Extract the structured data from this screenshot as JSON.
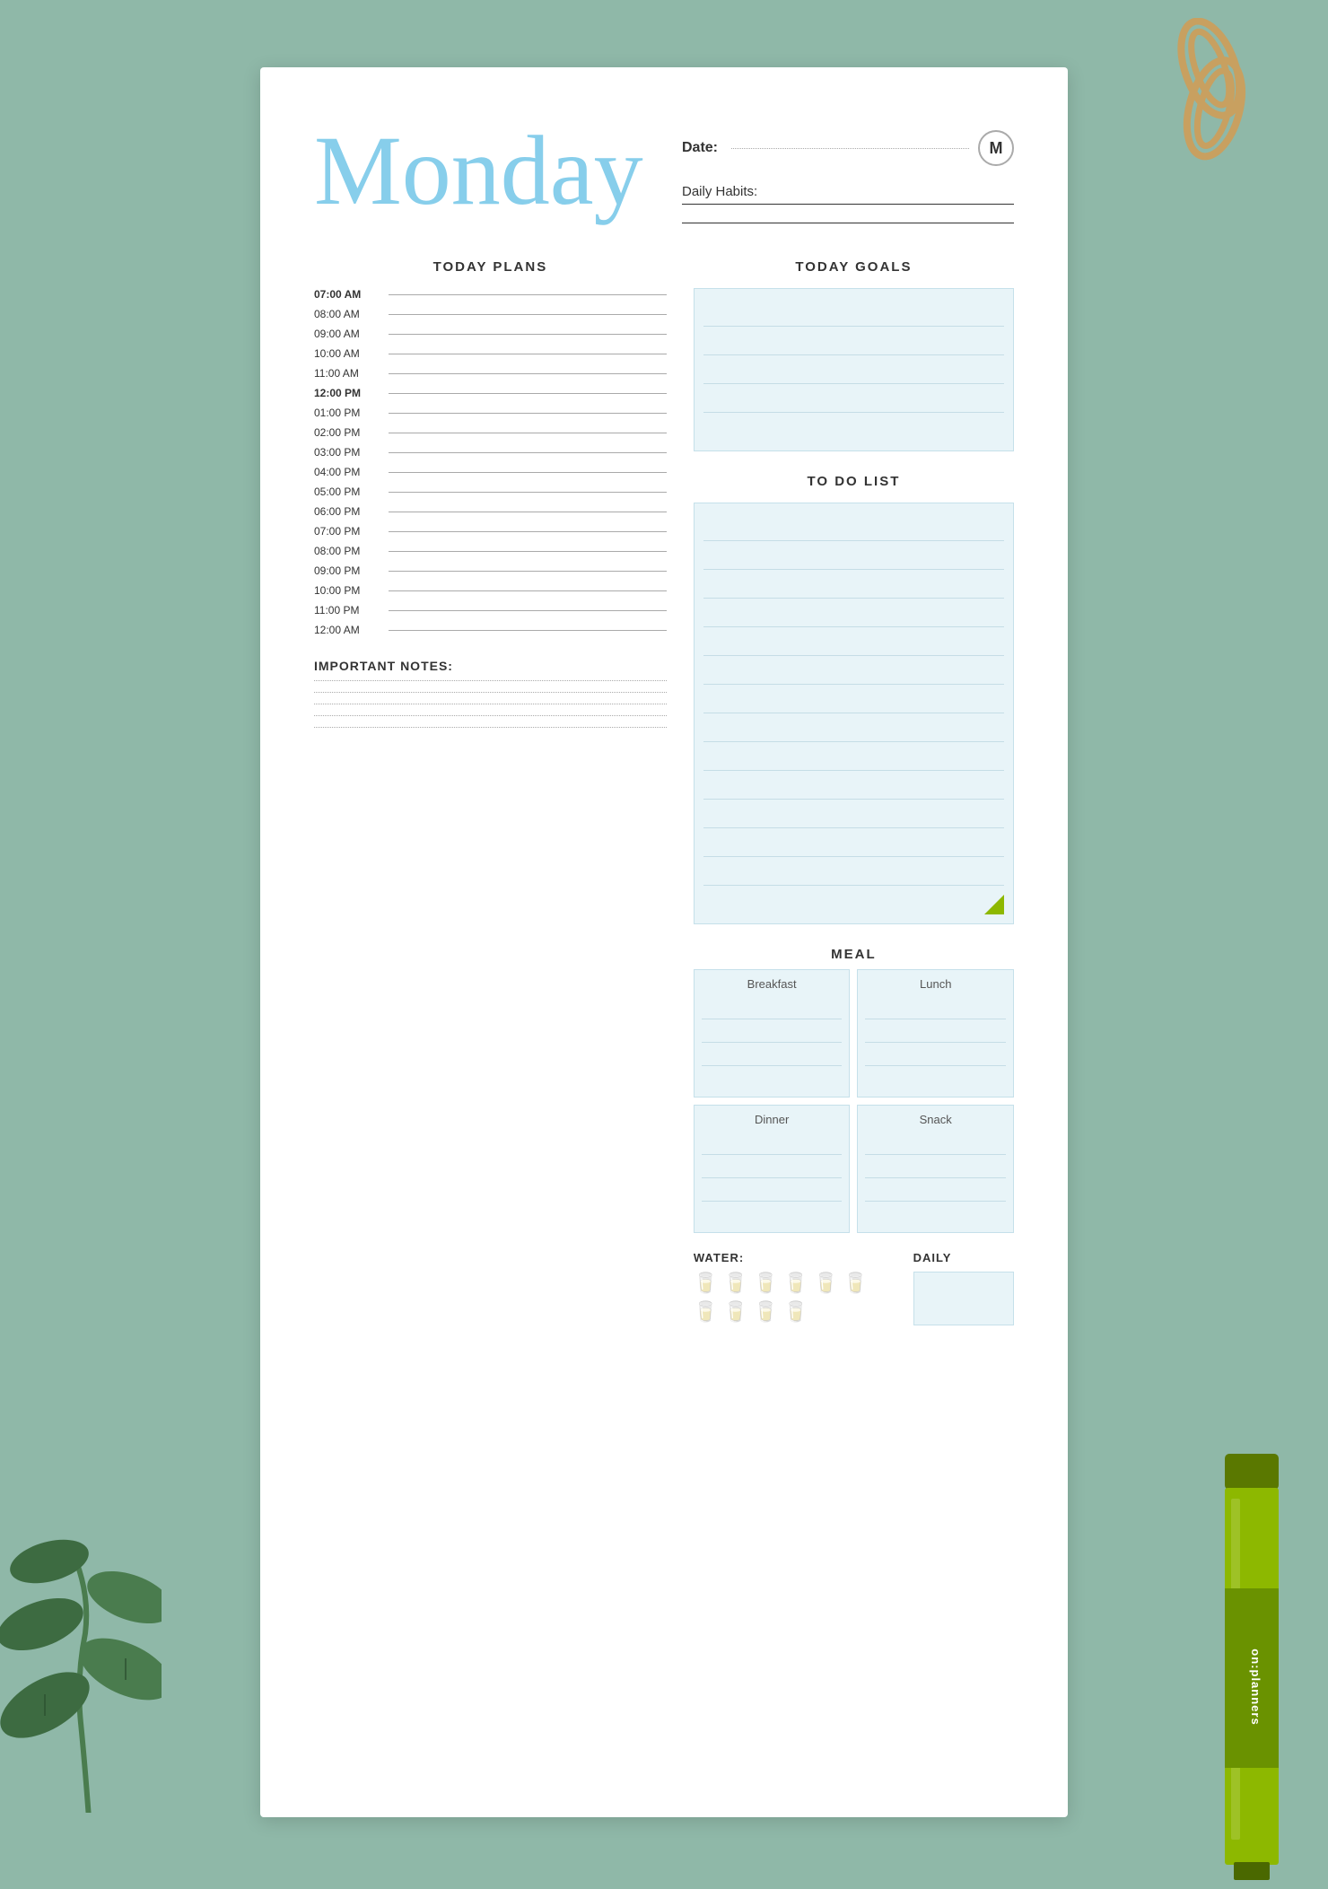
{
  "page": {
    "background_color": "#8fb8a8"
  },
  "header": {
    "day_title": "Monday",
    "date_label": "Date:",
    "monogram": "M",
    "habits_label": "Daily Habits:"
  },
  "today_plans": {
    "section_title": "TODAY PLANS",
    "time_slots": [
      {
        "time": "07:00 AM",
        "bold": true
      },
      {
        "time": "08:00 AM",
        "bold": false
      },
      {
        "time": "09:00 AM",
        "bold": false
      },
      {
        "time": "10:00 AM",
        "bold": false
      },
      {
        "time": "11:00 AM",
        "bold": false
      },
      {
        "time": "12:00 PM",
        "bold": true
      },
      {
        "time": "01:00 PM",
        "bold": false
      },
      {
        "time": "02:00 PM",
        "bold": false
      },
      {
        "time": "03:00 PM",
        "bold": false
      },
      {
        "time": "04:00 PM",
        "bold": false
      },
      {
        "time": "05:00 PM",
        "bold": false
      },
      {
        "time": "06:00 PM",
        "bold": false
      },
      {
        "time": "07:00 PM",
        "bold": false
      },
      {
        "time": "08:00 PM",
        "bold": false
      },
      {
        "time": "09:00 PM",
        "bold": false
      },
      {
        "time": "10:00 PM",
        "bold": false
      },
      {
        "time": "11:00 PM",
        "bold": false
      },
      {
        "time": "12:00 AM",
        "bold": false
      }
    ]
  },
  "today_goals": {
    "section_title": "TODAY GOALS",
    "line_count": 5
  },
  "todo_list": {
    "section_title": "TO DO LIST",
    "line_count": 14
  },
  "meal": {
    "section_title": "MEAL",
    "breakfast_label": "Breakfast",
    "lunch_label": "Lunch",
    "dinner_label": "Dinner",
    "snack_label": "Snack",
    "line_count_per_box": 4
  },
  "water": {
    "label": "WATER:",
    "glass_count": 10,
    "glass_icon": "🥛"
  },
  "daily": {
    "label": "DAILY"
  },
  "notes": {
    "label": "IMPORTANT NOTES:",
    "line_count": 5
  },
  "branding": {
    "label": "on:planners"
  }
}
